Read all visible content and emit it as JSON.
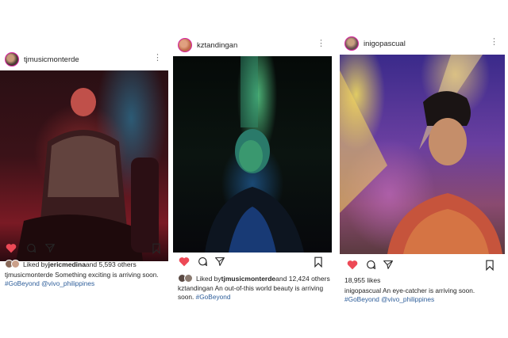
{
  "posts": [
    {
      "username": "tjmusicmonterde",
      "liked_by_prefix": "Liked by ",
      "liked_by_user": "jericmedina",
      "liked_by_suffix": " and 5,593 others",
      "caption_user": "tjmusicmonterde",
      "caption_text": " Something exciting is arriving soon.",
      "hashtags": "#GoBeyond @vivo_philippines"
    },
    {
      "username": "kztandingan",
      "liked_by_prefix": "Liked by ",
      "liked_by_user": "tjmusicmonterde",
      "liked_by_suffix": " and 12,424 others",
      "caption_user": "kztandingan",
      "caption_text": " An out-of-this world beauty is arriving soon.",
      "hashtags": "#GoBeyond"
    },
    {
      "username": "inigopascual",
      "likes": "18,955 likes",
      "caption_user": "inigopascual",
      "caption_text": " An eye-catcher is arriving soon.",
      "hashtags": "#GoBeyond @vivo_philippines"
    }
  ],
  "icons": [
    "more-icon",
    "heart-icon",
    "comment-icon",
    "share-icon",
    "bookmark-icon"
  ],
  "colors": {
    "like_red": "#ed4956",
    "hashtag_blue": "#2e5e9a",
    "text": "#262626"
  }
}
